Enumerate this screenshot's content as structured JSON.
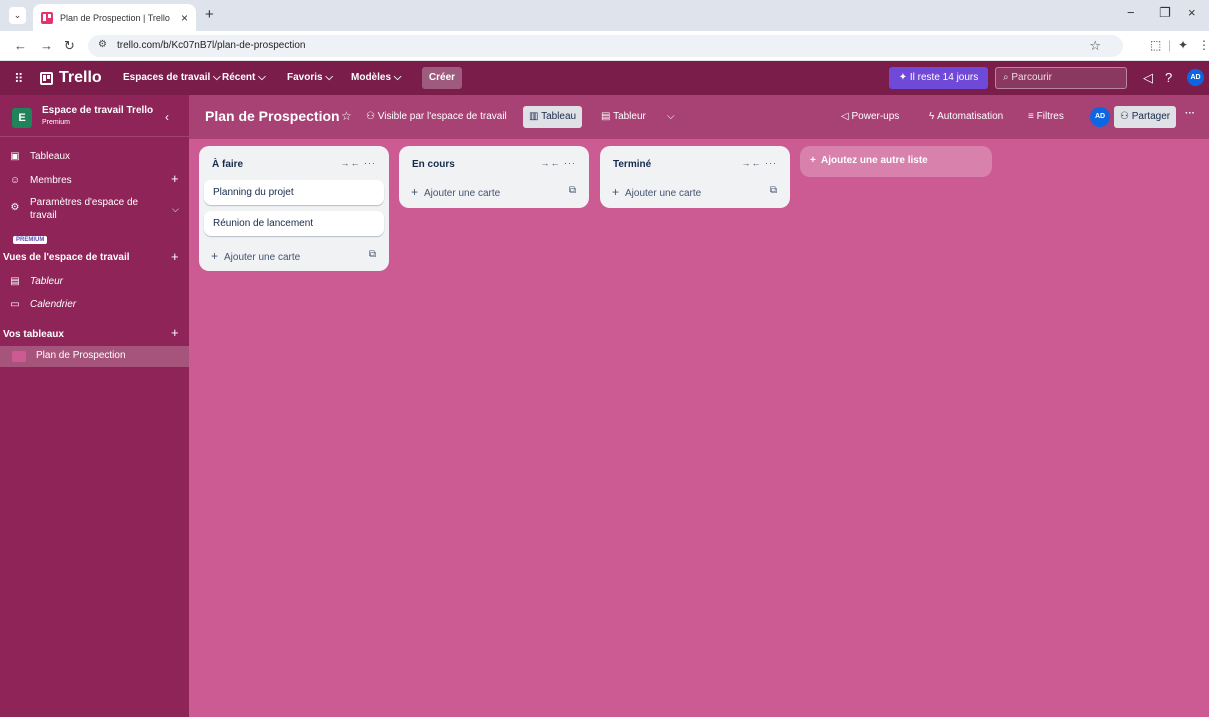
{
  "browser": {
    "tab_title": "Plan de Prospection | Trello",
    "tab_close": "×",
    "new_tab": "+",
    "url": "trello.com/b/Kc07nB7l/plan-de-prospection",
    "minimize": "−",
    "restore": "❐",
    "close": "×"
  },
  "header": {
    "app_name": "Trello",
    "nav": [
      "Espaces de travail",
      "Récent",
      "Favoris",
      "Modèles"
    ],
    "create": "Créer",
    "trial": "Il reste 14 jours",
    "search_placeholder": "Parcourir",
    "avatar": "AD"
  },
  "sidebar": {
    "workspace_initial": "E",
    "workspace_name": "Espace de travail Trello",
    "workspace_plan": "Premium",
    "items": [
      {
        "label": "Tableaux"
      },
      {
        "label": "Membres"
      },
      {
        "label": "Paramètres d'espace de"
      },
      {
        "label": "travail"
      }
    ],
    "premium_badge": "PREMIUM",
    "views_title": "Vues de l'espace de travail",
    "views": [
      {
        "label": "Tableur"
      },
      {
        "label": "Calendrier"
      }
    ],
    "boards_title": "Vos tableaux",
    "boards": [
      {
        "label": "Plan de Prospection"
      }
    ]
  },
  "board": {
    "title": "Plan de Prospection",
    "visibility": "Visible par l'espace de travail",
    "view_board": "Tableau",
    "view_table": "Tableur",
    "powerups": "Power-ups",
    "automation": "Automatisation",
    "filters": "Filtres",
    "avatar": "AD",
    "share": "Partager",
    "more": "···",
    "lists": [
      {
        "title": "À faire",
        "cards": [
          "Planning du projet",
          "Réunion de lancement"
        ],
        "add": "Ajouter une carte"
      },
      {
        "title": "En cours",
        "cards": [],
        "add": "Ajouter une carte"
      },
      {
        "title": "Terminé",
        "cards": [],
        "add": "Ajouter une carte"
      }
    ],
    "add_list": "Ajoutez une autre liste"
  },
  "colors": {
    "header": "#7a1d4b",
    "sidebar": "#8e2457",
    "board": "#cc5a93",
    "trial": "#6f49d8",
    "avatar": "#0c66e4",
    "workspace_badge": "#1f845a"
  }
}
